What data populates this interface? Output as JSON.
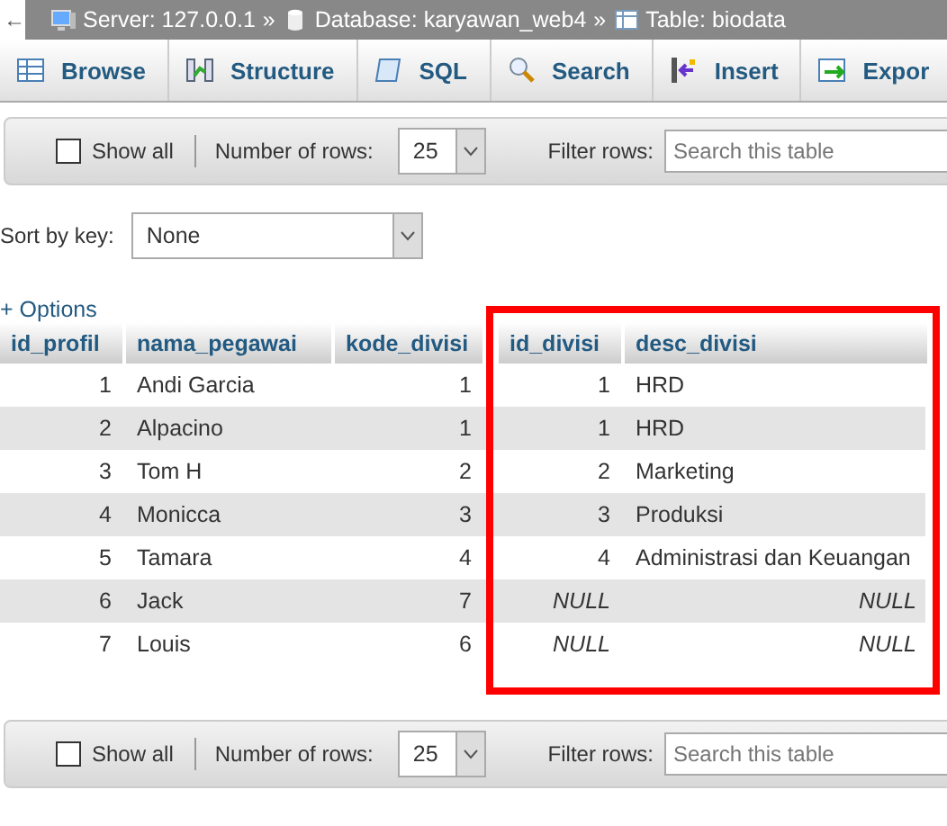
{
  "breadcrumb": {
    "back": "←",
    "items": [
      "Server: 127.0.0.1",
      "Database: karyawan_web4",
      "Table: biodata"
    ],
    "separator": "»"
  },
  "tabs": [
    "Browse",
    "Structure",
    "SQL",
    "Search",
    "Insert",
    "Expor"
  ],
  "navigation_top": {
    "show_all": {
      "label": "Show all",
      "checked": false
    },
    "rows_label": "Number of rows:",
    "rows_value": "25",
    "filter_label": "Filter rows:",
    "filter_placeholder": "Search this table"
  },
  "sort": {
    "label": "Sort by key:",
    "value": "None"
  },
  "options_link": "+ Options",
  "table": {
    "columns": [
      {
        "name": "id_profil",
        "kind": "number"
      },
      {
        "name": "nama_pegawai",
        "kind": "text"
      },
      {
        "name": "kode_divisi",
        "kind": "number"
      }
    ],
    "highlighted_columns": [
      {
        "name": "id_divisi",
        "kind": "number"
      },
      {
        "name": "desc_divisi",
        "kind": "text"
      }
    ],
    "rows": [
      [
        "1",
        "Andi Garcia",
        "1",
        "1",
        "HRD"
      ],
      [
        "2",
        "Alpacino",
        "1",
        "1",
        "HRD"
      ],
      [
        "3",
        "Tom H",
        "2",
        "2",
        "Marketing"
      ],
      [
        "4",
        "Monicca",
        "3",
        "3",
        "Produksi"
      ],
      [
        "5",
        "Tamara",
        "4",
        "4",
        "Administrasi dan Keuangan"
      ],
      [
        "6",
        "Jack",
        "7",
        {
          "text": "NULL",
          "kind": "null"
        },
        {
          "text": "NULL",
          "kind": "null"
        }
      ],
      [
        "7",
        "Louis",
        "6",
        {
          "text": "NULL",
          "kind": "null"
        },
        {
          "text": "NULL",
          "kind": "null"
        }
      ]
    ]
  },
  "navigation_bottom": {
    "show_all": {
      "label": "Show all",
      "checked": false
    },
    "rows_label": "Number of rows:",
    "rows_value": "25",
    "filter_label": "Filter rows:",
    "filter_placeholder": "Search this table"
  }
}
